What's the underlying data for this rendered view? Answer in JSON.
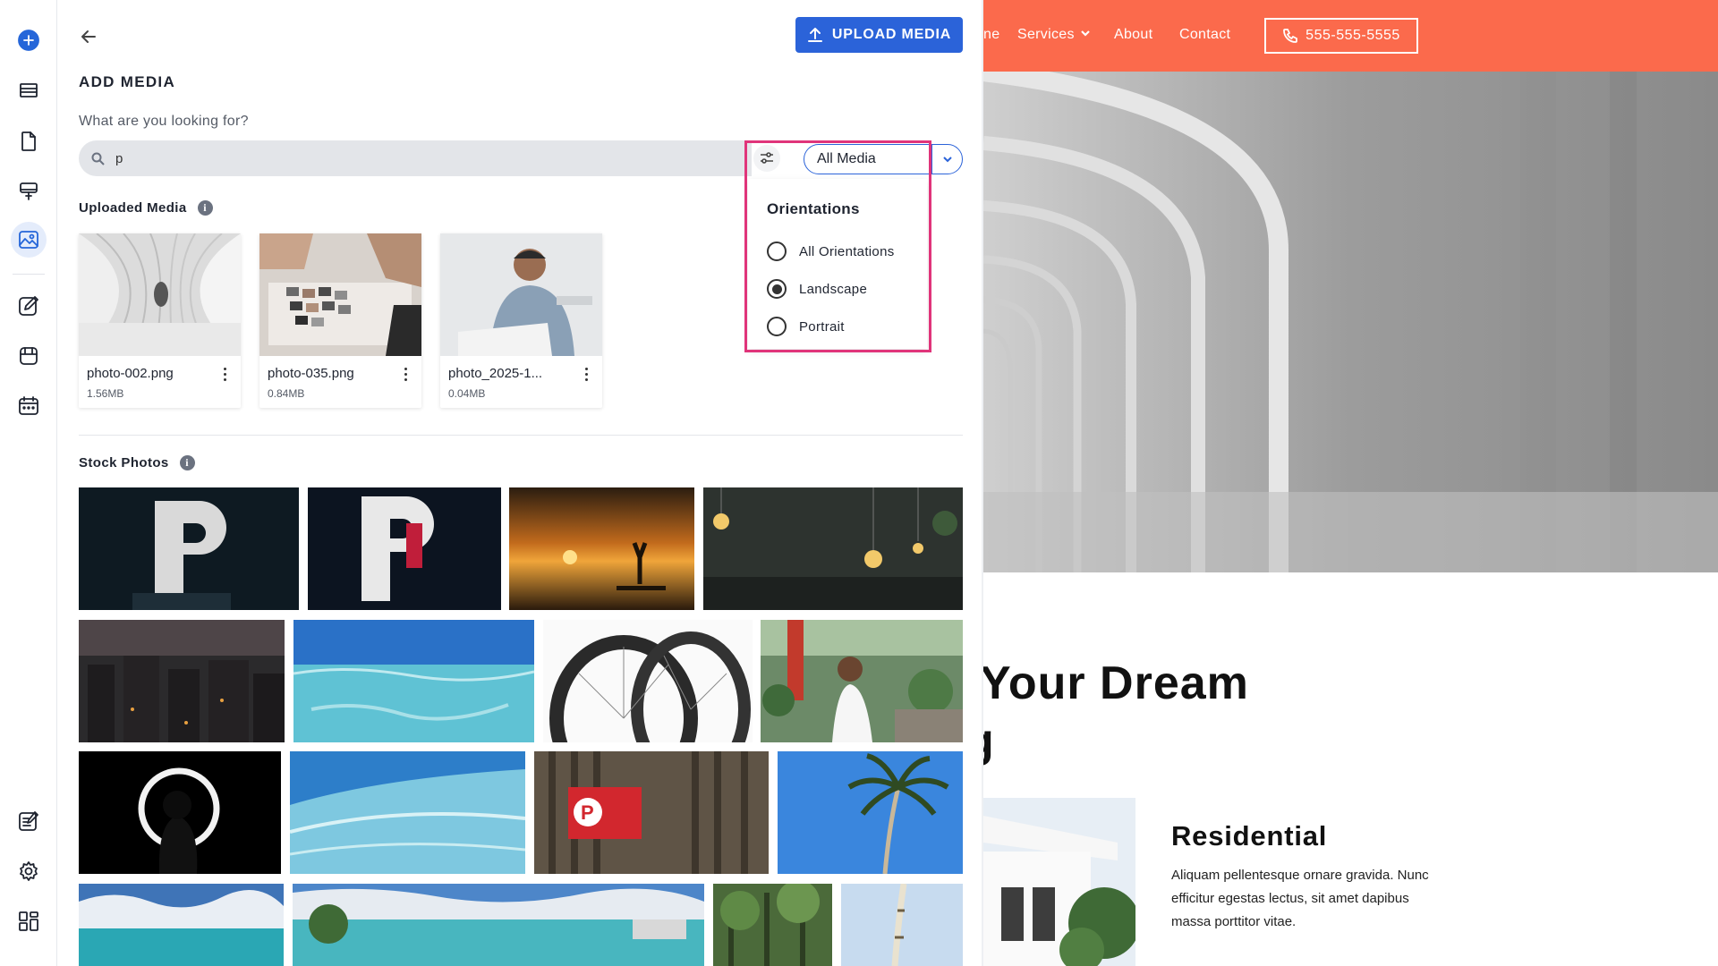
{
  "panel": {
    "title": "ADD MEDIA",
    "upload_label": "UPLOAD MEDIA",
    "search_prompt": "What are you looking for?",
    "search_value": "p",
    "media_filter": "All Media"
  },
  "orientations": {
    "title": "Orientations",
    "options": [
      {
        "label": "All Orientations",
        "selected": false
      },
      {
        "label": "Landscape",
        "selected": true
      },
      {
        "label": "Portrait",
        "selected": false
      }
    ]
  },
  "uploaded": {
    "label": "Uploaded Media",
    "items": [
      {
        "name": "photo-002.png",
        "size": "1.56MB"
      },
      {
        "name": "photo-035.png",
        "size": "0.84MB"
      },
      {
        "name": "photo_2025-1...",
        "size": "0.04MB"
      }
    ]
  },
  "stock": {
    "label": "Stock Photos"
  },
  "site": {
    "nav": {
      "partial_link": "ne",
      "services": "Services",
      "about": "About",
      "contact": "Contact",
      "phone": "555-555-5555"
    },
    "heading_line1": "Your Dream",
    "heading_line2": "g",
    "residential_title": "Residential",
    "residential_text": "Aliquam pellentesque ornare gravida. Nunc efficitur egestas lectus, sit amet dapibus massa porttitor vitae."
  },
  "colors": {
    "accent": "#2b63d9",
    "highlight": "#e0347a",
    "site_nav": "#fb6a4c"
  }
}
